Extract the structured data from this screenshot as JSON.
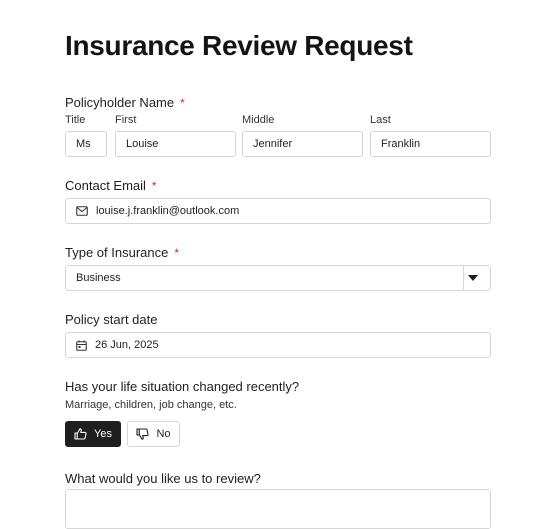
{
  "form": {
    "title": "Insurance Review Request",
    "policyholder": {
      "label": "Policyholder Name",
      "required_mark": "*",
      "title_label": "Title",
      "title_value": "Ms",
      "first_label": "First",
      "first_value": "Louise",
      "middle_label": "Middle",
      "middle_value": "Jennifer",
      "last_label": "Last",
      "last_value": "Franklin"
    },
    "email": {
      "label": "Contact Email",
      "required_mark": "*",
      "value": "louise.j.franklin@outlook.com",
      "icon": "mail-icon"
    },
    "insurance_type": {
      "label": "Type of Insurance",
      "required_mark": "*",
      "selected": "Business",
      "icon": "caret-down-icon"
    },
    "start_date": {
      "label": "Policy start date",
      "value": "26 Jun, 2025",
      "icon": "calendar-icon"
    },
    "life_change": {
      "question": "Has your life situation changed recently?",
      "hint": "Marriage, children, job change, etc.",
      "yes_label": "Yes",
      "no_label": "No",
      "yes_icon": "thumbs-up-icon",
      "no_icon": "thumbs-down-icon",
      "selected": "Yes"
    },
    "review": {
      "question": "What would you like us to review?"
    }
  },
  "colors": {
    "required": "#e5195f",
    "border": "#d6d6d6",
    "selected_button": "#1f1f1f"
  }
}
